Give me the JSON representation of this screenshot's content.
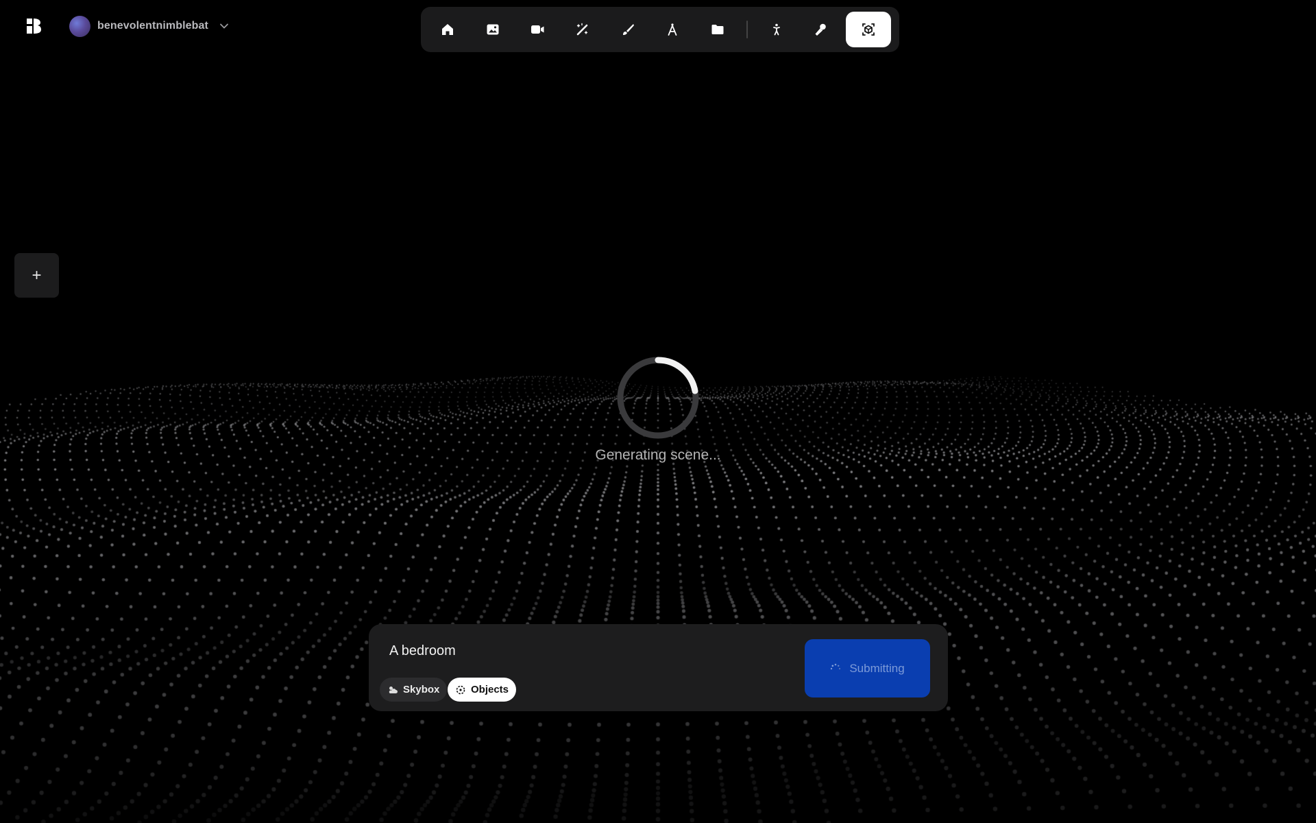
{
  "account": {
    "username": "benevolentnimblebat"
  },
  "toolbar": {
    "items": [
      {
        "icon": "home-icon",
        "label": ""
      },
      {
        "icon": "image-icon",
        "label": ""
      },
      {
        "icon": "video-icon",
        "label": ""
      },
      {
        "icon": "magic-wand-icon",
        "label": ""
      },
      {
        "icon": "brush-icon",
        "label": ""
      },
      {
        "icon": "compass-icon",
        "label": ""
      },
      {
        "icon": "folder-icon",
        "label": ""
      },
      {
        "icon": "person-icon",
        "label": ""
      },
      {
        "icon": "microphone-icon",
        "label": ""
      },
      {
        "icon": "3d-scene-icon",
        "label": "",
        "active": true
      }
    ]
  },
  "sidebar": {
    "add_label": "+"
  },
  "status": {
    "text": "Generating scene..."
  },
  "prompt": {
    "value": "A bedroom",
    "chips": {
      "skybox": "Skybox",
      "objects": "Objects"
    },
    "submit_label": "Submitting"
  },
  "colors": {
    "accent": "#0a3eb0",
    "background": "#000000",
    "panel": "#1d1d1e"
  }
}
